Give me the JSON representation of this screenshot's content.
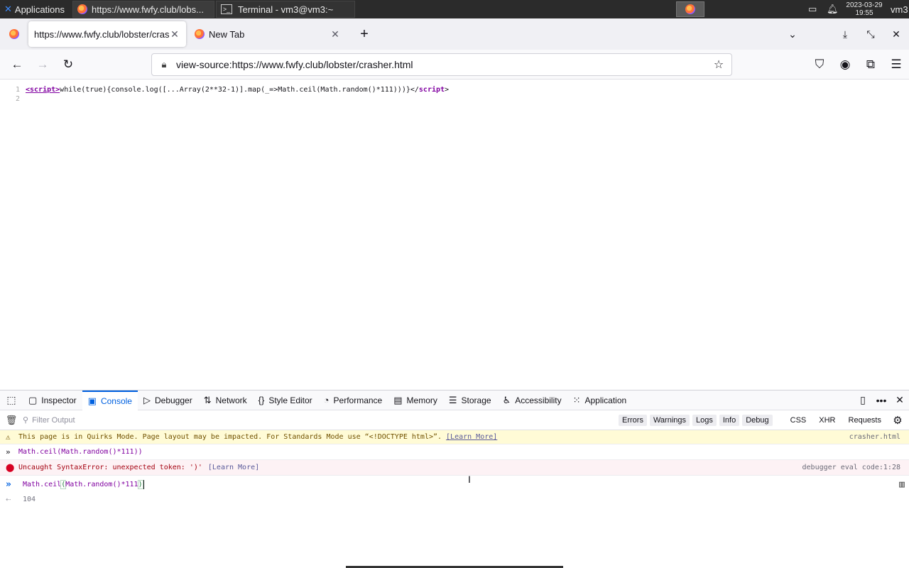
{
  "taskbar": {
    "applications_label": "Applications",
    "tasks": [
      {
        "label": "https://www.fwfy.club/lobs..."
      },
      {
        "label": "Terminal - vm3@vm3:~"
      }
    ],
    "clock": {
      "date": "2023-03-29",
      "time": "19:55"
    },
    "user": "vm3"
  },
  "browser": {
    "tabs": [
      {
        "title": "https://www.fwfy.club/lobster/crasher.html"
      },
      {
        "title": "New Tab"
      }
    ],
    "url": "view-source:https://www.fwfy.club/lobster/crasher.html"
  },
  "source": {
    "lines": [
      {
        "number": "1",
        "open_tag": "<script>",
        "body": "while(true){console.log([...Array(2**32-1)].map(_=>Math.ceil(Math.random()*111)))}",
        "close_tag_lt": "</",
        "close_tag_name": "script",
        "close_tag_gt": ">"
      },
      {
        "number": "2"
      }
    ]
  },
  "devtools": {
    "tabs": [
      {
        "label": "Inspector",
        "icon": "inspector-icon"
      },
      {
        "label": "Console",
        "icon": "console-icon",
        "active": true
      },
      {
        "label": "Debugger",
        "icon": "debugger-icon"
      },
      {
        "label": "Network",
        "icon": "network-icon"
      },
      {
        "label": "Style Editor",
        "icon": "style-editor-icon"
      },
      {
        "label": "Performance",
        "icon": "performance-icon"
      },
      {
        "label": "Memory",
        "icon": "memory-icon"
      },
      {
        "label": "Storage",
        "icon": "storage-icon"
      },
      {
        "label": "Accessibility",
        "icon": "accessibility-icon"
      },
      {
        "label": "Application",
        "icon": "application-icon"
      }
    ],
    "filter_placeholder": "Filter Output",
    "filter_buttons": [
      "Errors",
      "Warnings",
      "Logs",
      "Info",
      "Debug"
    ],
    "net_filters": [
      "CSS",
      "XHR",
      "Requests"
    ],
    "messages": {
      "warning": {
        "text": "This page is in Quirks Mode. Page layout may be impacted. For Standards Mode use “<!DOCTYPE html>”.",
        "learn_more": "[Learn More]",
        "location": "crasher.html"
      },
      "input1": {
        "fn": "Math.ceil",
        "open": "(",
        "inner": "Math.random",
        "rest": "()*111))"
      },
      "error": {
        "text": "Uncaught SyntaxError: unexpected token: ')'",
        "learn_more": "[Learn More]",
        "location": "debugger eval code:1:28"
      },
      "prompt": {
        "fn": "Math.ceil",
        "open": "(",
        "inner": "Math.random",
        "rest": "()*111",
        "close": ")"
      },
      "result": "104"
    }
  },
  "colors": {
    "accent": "#0061e0",
    "warning_bg": "#fffbd6",
    "error_bg": "#fdf2f5",
    "error_text": "#a4000f"
  }
}
